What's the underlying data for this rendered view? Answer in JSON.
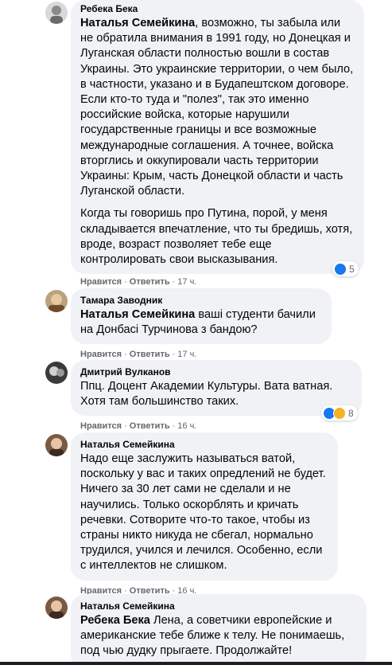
{
  "comments": [
    {
      "author": "Ребека Бека",
      "mention": "Наталья Семейкина",
      "paragraphs": [
        ", возможно, ты забыла или не обратила внимания в 1991 году, но Донецкая и Луганская области полностью вошли в состав Украины. Это украинские территории, о чем было, в частности, указано и в Будапештском договоре. Если кто-то туда и \"полез\", так это именно российские войска, которые нарушили государственные границы и все возможные международные соглашения. А точнее, войска вторглись и оккупировали часть территории Украины: Крым, часть Донецкой области и часть Луганской области.",
        "Когда ты говоришь про Путина, порой, у меня складывается впечатление, что ты бредишь, хотя, вроде, возраст позволяет тебе еще контролировать свои высказывания."
      ],
      "like": "Нравится",
      "reply": "Ответить",
      "time": "17 ч.",
      "reaction_count": "5"
    },
    {
      "author": "Тамара Заводник",
      "mention": "Наталья Семейкина",
      "text": " ваші студенти бачили на Донбасі Турчинова з бандою?",
      "like": "Нравится",
      "reply": "Ответить",
      "time": "17 ч."
    },
    {
      "author": "Дмитрий Вулканов",
      "text": "Ппц. Доцент Академии Культуры. Вата ватная. Хотя там большинство таких.",
      "like": "Нравится",
      "reply": "Ответить",
      "time": "16 ч.",
      "reaction_count": "8"
    },
    {
      "author": "Наталья Семейкина",
      "text": "Надо еще заслужить называться ватой, поскольку у вас и таких опредлений не будет. Ничего за 30 лет сами не сделали и не научились. Только оскорблять и кричать речевки. Сотворите что-то такое, чтобы из страны никто никуда не сбегал, нормально трудился, учился и лечился. Особенно, если с интеллектов не слишком.",
      "like": "Нравится",
      "reply": "Ответить",
      "time": "16 ч."
    },
    {
      "author": "Наталья Семейкина",
      "mention": "Ребека Бека",
      "text": " Лена, а советчики европейские и американские тебе ближе к телу. Не понимаешь, под чью дудку прыгаете. Продолжайте!"
    }
  ],
  "separator": "·",
  "colors": {
    "bubble": "#f0f2f5",
    "meta": "#65676b",
    "like": "#1877f2",
    "sad": "#f7b125"
  },
  "icons": {
    "like": "like-reaction-icon",
    "sad": "sad-reaction-icon"
  }
}
